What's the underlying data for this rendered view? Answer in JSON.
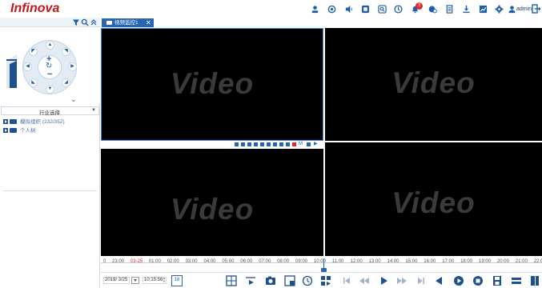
{
  "brand": {
    "logo_text": "Infinova",
    "logo_color": "#c8161d",
    "accent": "#2866b2"
  },
  "topbar": {
    "icons": [
      "person-pin-icon",
      "camera-settings-icon",
      "audio-icon",
      "screen-icon",
      "search-image-icon",
      "playback-icon",
      "notification-icon",
      "settings-alt-icon",
      "document-icon",
      "download-icon",
      "chart-icon",
      "gear-icon",
      "user-icon",
      "logout-icon"
    ],
    "notification_count": "3",
    "user": "admin"
  },
  "left_panel": {
    "toolbar_icons": [
      "filter-icon",
      "search-icon",
      "collapse-up-icon"
    ],
    "industry_select": {
      "label": "行业选择"
    },
    "tree": [
      {
        "label": "模拟组织 (232/352)"
      },
      {
        "label": "个人树"
      }
    ]
  },
  "tabs": [
    {
      "label": "视频监控1",
      "active": true
    }
  ],
  "video_cells": [
    {
      "label": "Video"
    },
    {
      "label": "Video"
    },
    {
      "label": "Video"
    },
    {
      "label": "Video"
    }
  ],
  "timeline": {
    "start_label": "0",
    "ticks": [
      "23:00",
      "03-25",
      "01:00",
      "02:00",
      "03:00",
      "04:00",
      "05:00",
      "06:00",
      "07:00",
      "08:00",
      "09:00",
      "10:00",
      "11:00",
      "12:00",
      "13:00",
      "14:00",
      "15:00",
      "16:00",
      "17:00",
      "18:00",
      "19:00",
      "20:00",
      "21:00",
      "22:0"
    ],
    "highlight_tick": "03-25"
  },
  "controls": {
    "date": "2019/ 3/25",
    "time": "10:15:56",
    "calendar_day": "18"
  }
}
